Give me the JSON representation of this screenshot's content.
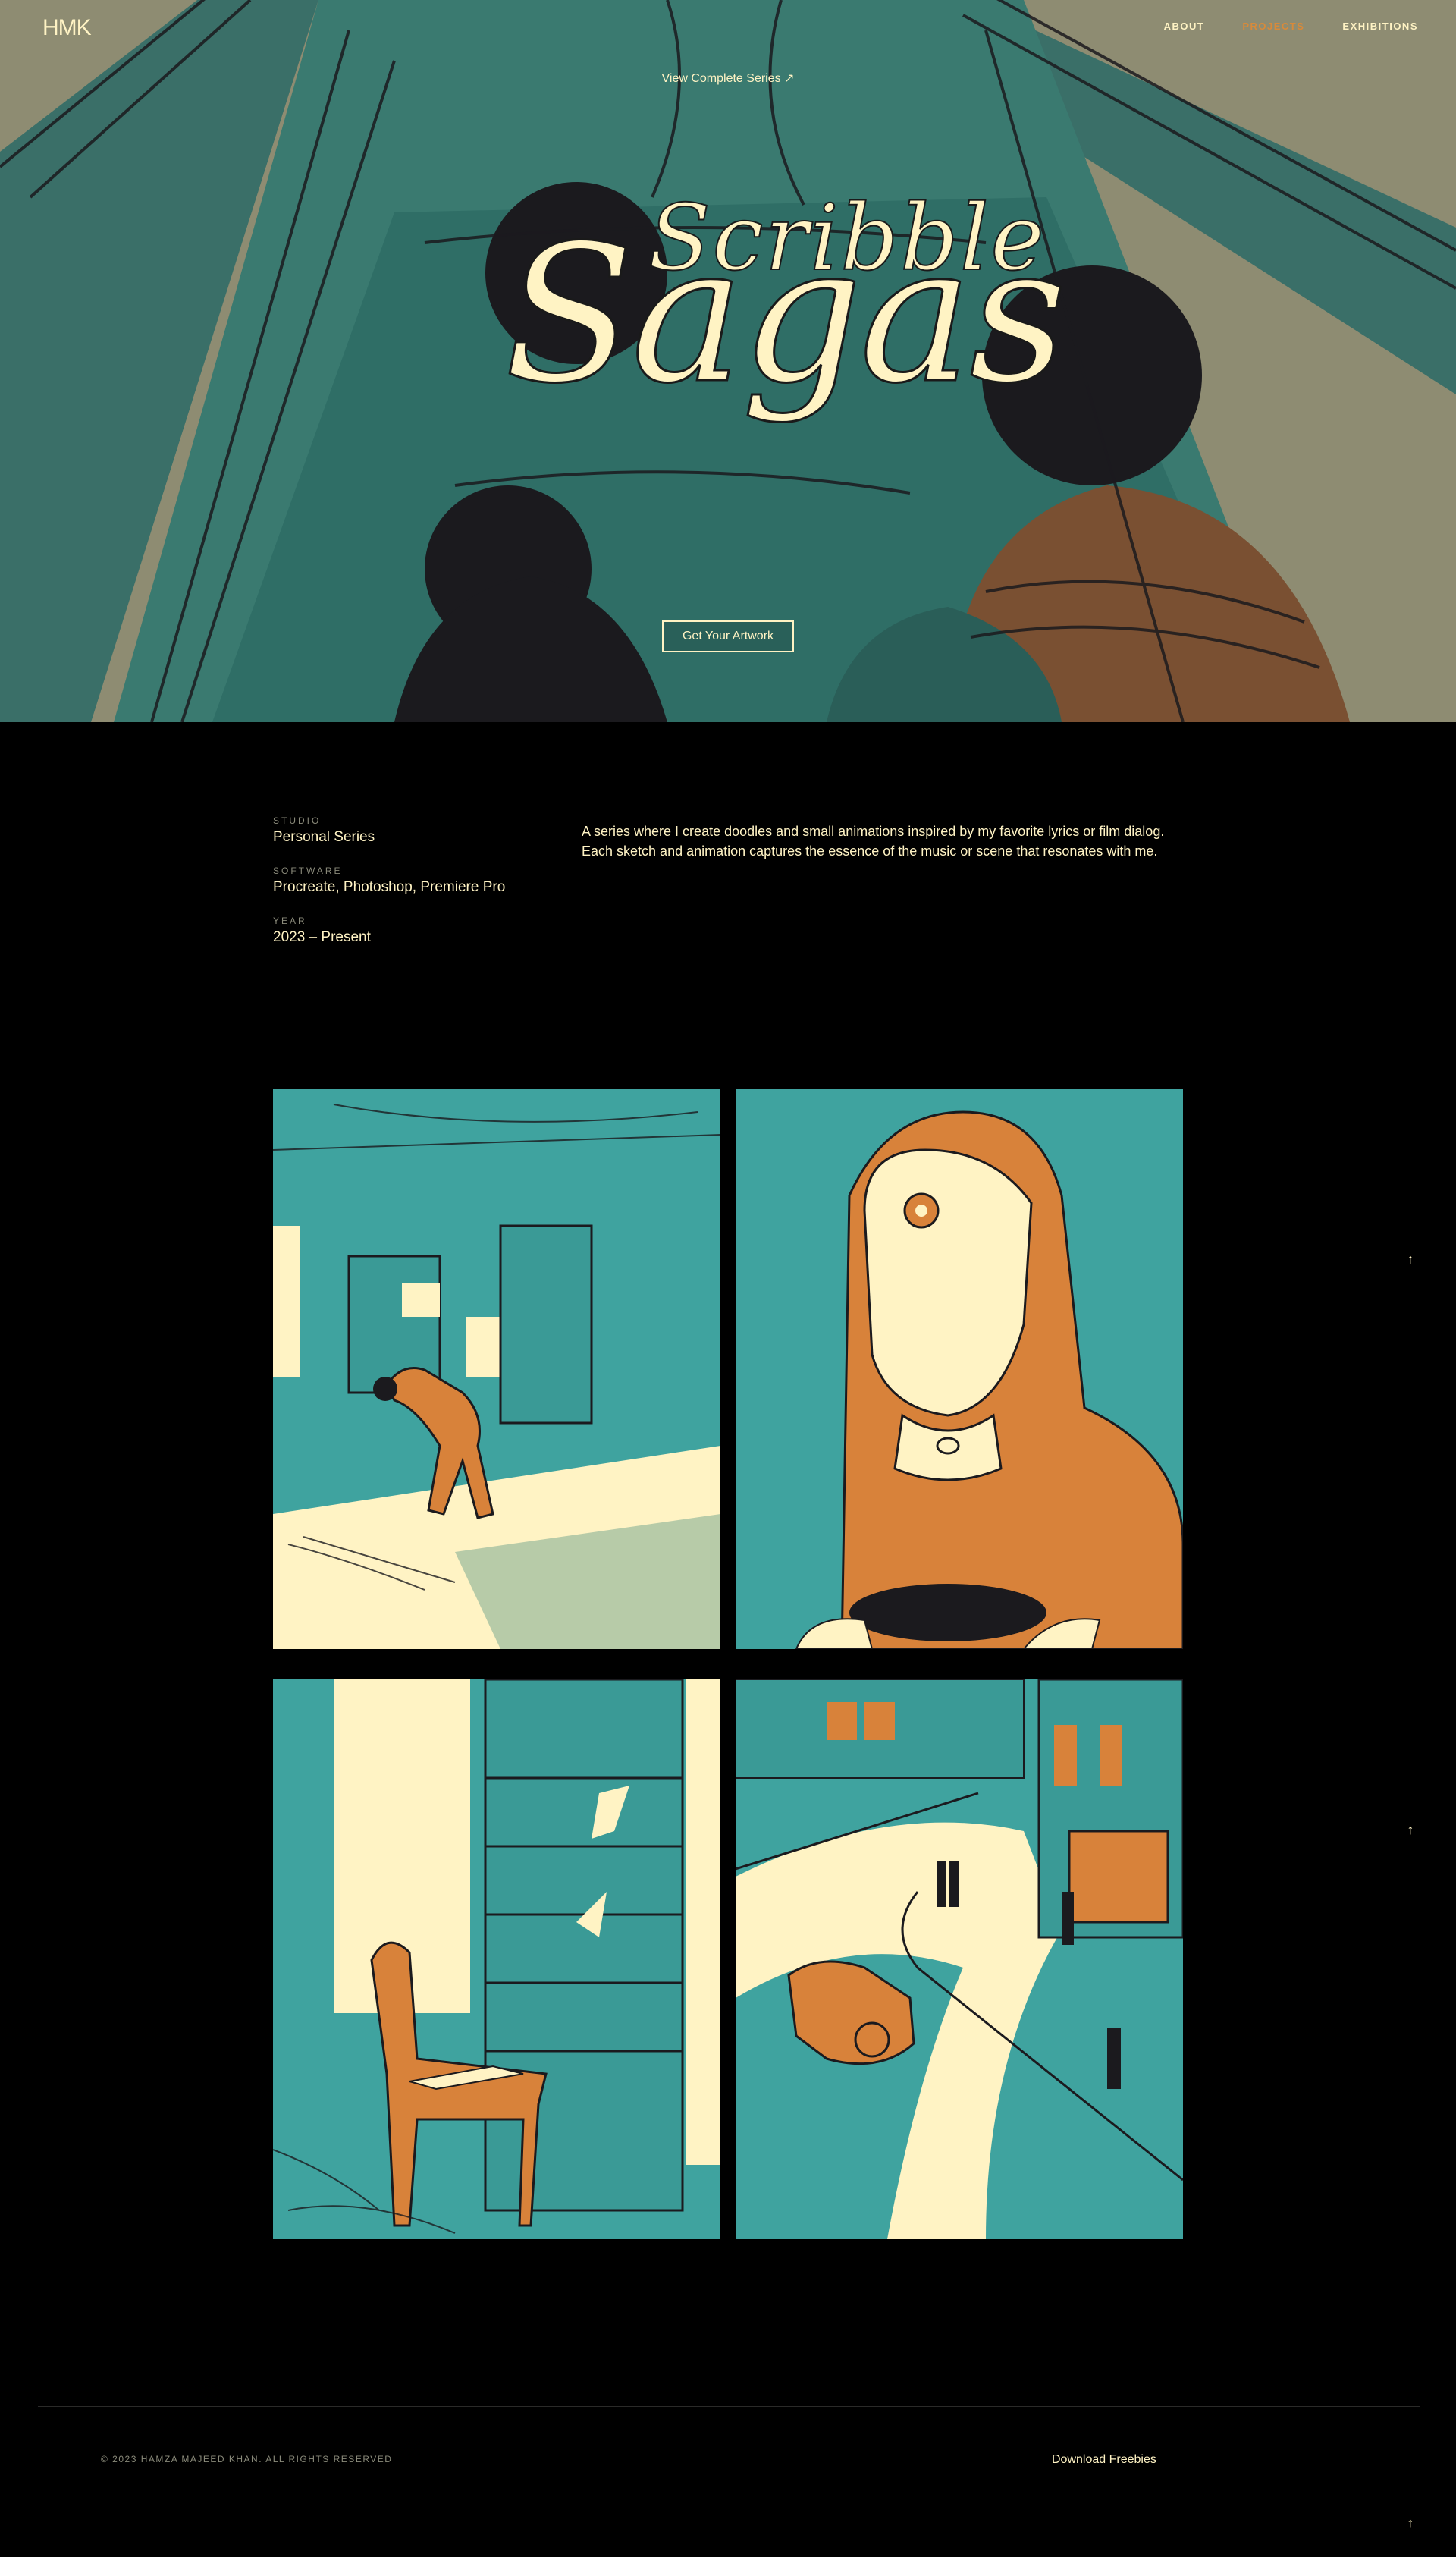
{
  "nav": {
    "logo": "HMK",
    "links": [
      {
        "label": "ABOUT",
        "active": false
      },
      {
        "label": "PROJECTS",
        "active": true
      },
      {
        "label": "EXHIBITIONS",
        "active": false
      }
    ]
  },
  "hero": {
    "view_series": "View Complete Series ↗",
    "title_top": "Scribble",
    "title_main": "Sagas",
    "cta": "Get Your Artwork"
  },
  "info": {
    "studio_label": "STUDIO",
    "studio_value": "Personal Series",
    "software_label": "SOFTWARE",
    "software_value": "Procreate, Photoshop, Premiere Pro",
    "year_label": "YEAR",
    "year_value": "2023 – Present",
    "description": "A series where I create doodles and small animations inspired by my favorite lyrics or film dialog. Each sketch and animation captures the essence of the music or scene that resonates with me."
  },
  "gallery": {
    "items": [
      {
        "name": "man-in-room"
      },
      {
        "name": "woman-with-veil"
      },
      {
        "name": "chair-by-bookshelf"
      },
      {
        "name": "street-with-car"
      }
    ]
  },
  "scroll_top_icon": "arrow-up-icon",
  "scroll_top_glyph": "↑",
  "footer": {
    "copyright": "© 2023 HAMZA MAJEED KHAN. ALL RIGHTS RESERVED",
    "download": "Download Freebies"
  },
  "colors": {
    "teal": "#3fa39f",
    "cream": "#fff3c4",
    "orange": "#d8823a",
    "dark": "#1b1a1e",
    "olive": "#8e8c72"
  }
}
